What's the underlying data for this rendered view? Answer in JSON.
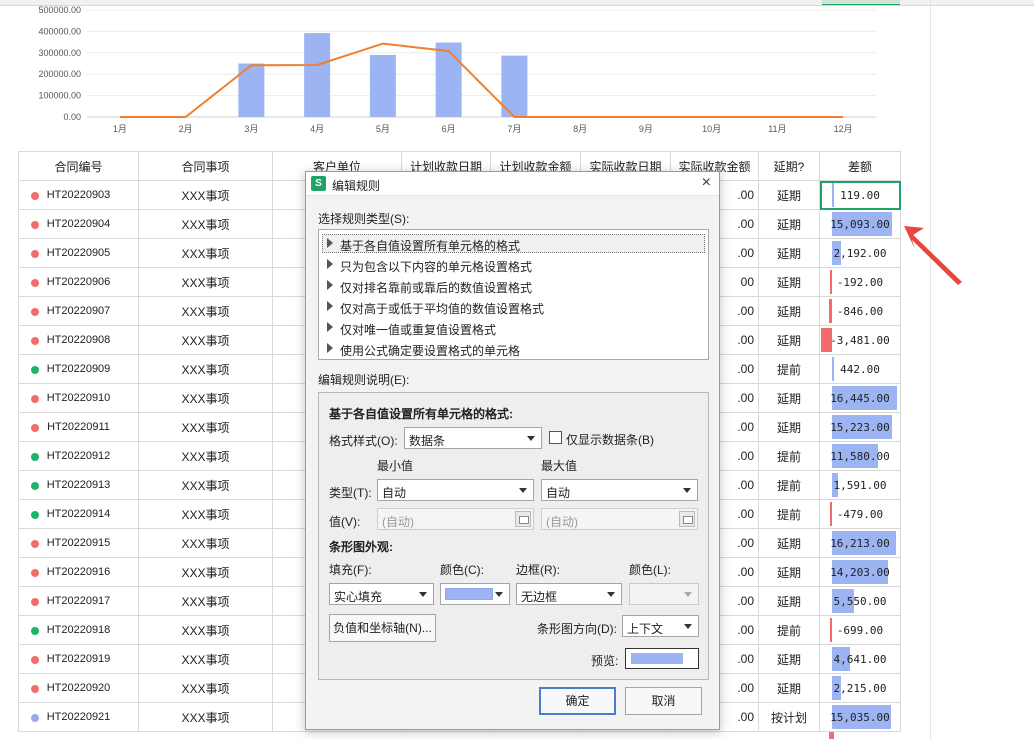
{
  "colors": {
    "accent": "#21a366",
    "bar": "#9db4f3",
    "line": "#f07f2f",
    "dot_red": "#f26c6c",
    "dot_green": "#1fb36b",
    "dot_blue": "#9aa8f0",
    "neg_bar": "#f26c6c",
    "annotation": "#e8453c"
  },
  "chart_data": {
    "type": "bar+line",
    "categories": [
      "1月",
      "2月",
      "3月",
      "4月",
      "5月",
      "6月",
      "7月",
      "8月",
      "9月",
      "10月",
      "11月",
      "12月"
    ],
    "bars": [
      0,
      0,
      250000,
      392000,
      290000,
      348000,
      287000,
      0,
      0,
      0,
      0,
      0
    ],
    "line": [
      0,
      0,
      242000,
      243000,
      343000,
      308000,
      0,
      0,
      0,
      0,
      0,
      0
    ],
    "yticks": [
      "0.00",
      "100000.00",
      "200000.00",
      "300000.00",
      "400000.00",
      "500000.00"
    ],
    "ylim": [
      0,
      500000
    ]
  },
  "sheet": {
    "headers": [
      "合同编号",
      "合同事项",
      "客户单位",
      "计划收款日期",
      "计划收款金额",
      "实际收款日期",
      "实际收款金额",
      "延期?",
      "差额"
    ],
    "rows": [
      {
        "dot": "red",
        "code": "HT20220903",
        "item": "XXX事项",
        "amt": ".00",
        "status": "延期",
        "diff": "119.00",
        "d": 119
      },
      {
        "dot": "red",
        "code": "HT20220904",
        "item": "XXX事项",
        "amt": ".00",
        "status": "延期",
        "diff": "15,093.00",
        "d": 15093
      },
      {
        "dot": "red",
        "code": "HT20220905",
        "item": "XXX事项",
        "amt": ".00",
        "status": "延期",
        "diff": "2,192.00",
        "d": 2192
      },
      {
        "dot": "red",
        "code": "HT20220906",
        "item": "XXX事项",
        "amt": "00",
        "status": "延期",
        "diff": "-192.00",
        "d": -192
      },
      {
        "dot": "red",
        "code": "HT20220907",
        "item": "XXX事项",
        "amt": ".00",
        "status": "延期",
        "diff": "-846.00",
        "d": -846
      },
      {
        "dot": "red",
        "code": "HT20220908",
        "item": "XXX事项",
        "amt": ".00",
        "status": "延期",
        "diff": "-3,481.00",
        "d": -3481
      },
      {
        "dot": "green",
        "code": "HT20220909",
        "item": "XXX事项",
        "amt": ".00",
        "status": "提前",
        "diff": "442.00",
        "d": 442
      },
      {
        "dot": "red",
        "code": "HT20220910",
        "item": "XXX事项",
        "amt": ".00",
        "status": "延期",
        "diff": "16,445.00",
        "d": 16445
      },
      {
        "dot": "red",
        "code": "HT20220911",
        "item": "XXX事项",
        "amt": ".00",
        "status": "延期",
        "diff": "15,223.00",
        "d": 15223
      },
      {
        "dot": "green",
        "code": "HT20220912",
        "item": "XXX事项",
        "amt": ".00",
        "status": "提前",
        "diff": "11,580.00",
        "d": 11580
      },
      {
        "dot": "green",
        "code": "HT20220913",
        "item": "XXX事项",
        "amt": ".00",
        "status": "提前",
        "diff": "1,591.00",
        "d": 1591
      },
      {
        "dot": "green",
        "code": "HT20220914",
        "item": "XXX事项",
        "amt": ".00",
        "status": "提前",
        "diff": "-479.00",
        "d": -479
      },
      {
        "dot": "red",
        "code": "HT20220915",
        "item": "XXX事项",
        "amt": ".00",
        "status": "延期",
        "diff": "16,213.00",
        "d": 16213
      },
      {
        "dot": "red",
        "code": "HT20220916",
        "item": "XXX事项",
        "amt": ".00",
        "status": "延期",
        "diff": "14,203.00",
        "d": 14203
      },
      {
        "dot": "red",
        "code": "HT20220917",
        "item": "XXX事项",
        "amt": ".00",
        "status": "延期",
        "diff": "5,550.00",
        "d": 5550
      },
      {
        "dot": "green",
        "code": "HT20220918",
        "item": "XXX事项",
        "amt": ".00",
        "status": "提前",
        "diff": "-699.00",
        "d": -699
      },
      {
        "dot": "red",
        "code": "HT20220919",
        "item": "XXX事项",
        "amt": ".00",
        "status": "延期",
        "diff": "4,641.00",
        "d": 4641
      },
      {
        "dot": "red",
        "code": "HT20220920",
        "item": "XXX事项",
        "amt": ".00",
        "status": "延期",
        "diff": "2,215.00",
        "d": 2215
      },
      {
        "dot": "blue",
        "code": "HT20220921",
        "item": "XXX事项",
        "amt": ".00",
        "status": "按计划",
        "diff": "15,035.00",
        "d": 15035
      }
    ]
  },
  "dialog": {
    "title": "编辑规则",
    "icon": "wps-s-icon",
    "close": "×",
    "select_type_label": "选择规则类型(S):",
    "rule_types": [
      "基于各自值设置所有单元格的格式",
      "只为包含以下内容的单元格设置格式",
      "仅对排名靠前或靠后的数值设置格式",
      "仅对高于或低于平均值的数值设置格式",
      "仅对唯一值或重复值设置格式",
      "使用公式确定要设置格式的单元格"
    ],
    "edit_desc_label": "编辑规则说明(E):",
    "section_title": "基于各自值设置所有单元格的格式:",
    "format_style_label": "格式样式(O):",
    "format_style_value": "数据条",
    "show_bar_only_label": "仅显示数据条(B)",
    "min_label": "最小值",
    "max_label": "最大值",
    "type_label": "类型(T):",
    "type_min_value": "自动",
    "type_max_value": "自动",
    "value_label": "值(V):",
    "value_min_placeholder": "(自动)",
    "value_max_placeholder": "(自动)",
    "bar_appearance_label": "条形图外观:",
    "fill_label": "填充(F):",
    "fill_value": "实心填充",
    "color_label": "颜色(C):",
    "border_label": "边框(R):",
    "border_value": "无边框",
    "border_color_label": "颜色(L):",
    "neg_axis_button": "负值和坐标轴(N)...",
    "direction_label": "条形图方向(D):",
    "direction_value": "上下文",
    "preview_label": "预览:",
    "ok_button": "确定",
    "cancel_button": "取消"
  }
}
